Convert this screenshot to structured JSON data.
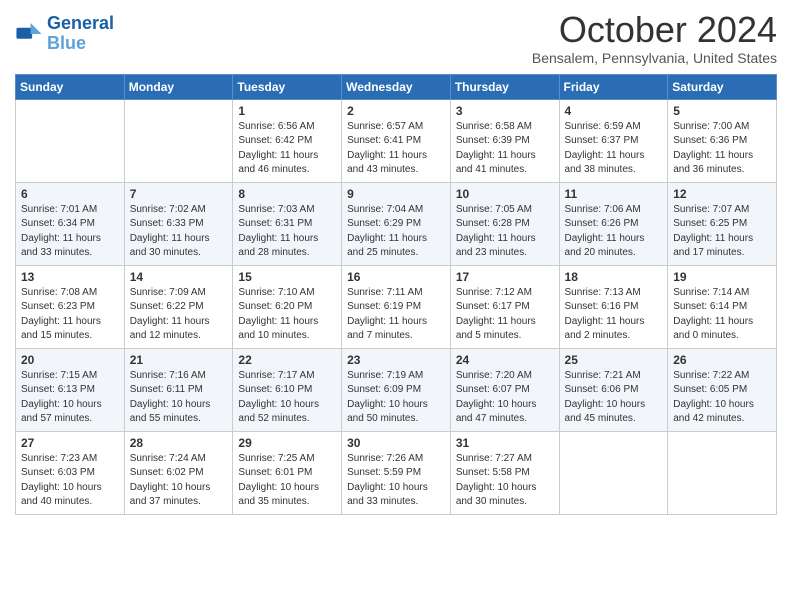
{
  "header": {
    "logo_line1": "General",
    "logo_line2": "Blue",
    "month": "October 2024",
    "location": "Bensalem, Pennsylvania, United States"
  },
  "weekdays": [
    "Sunday",
    "Monday",
    "Tuesday",
    "Wednesday",
    "Thursday",
    "Friday",
    "Saturday"
  ],
  "weeks": [
    [
      {
        "day": "",
        "info": ""
      },
      {
        "day": "",
        "info": ""
      },
      {
        "day": "1",
        "info": "Sunrise: 6:56 AM\nSunset: 6:42 PM\nDaylight: 11 hours and 46 minutes."
      },
      {
        "day": "2",
        "info": "Sunrise: 6:57 AM\nSunset: 6:41 PM\nDaylight: 11 hours and 43 minutes."
      },
      {
        "day": "3",
        "info": "Sunrise: 6:58 AM\nSunset: 6:39 PM\nDaylight: 11 hours and 41 minutes."
      },
      {
        "day": "4",
        "info": "Sunrise: 6:59 AM\nSunset: 6:37 PM\nDaylight: 11 hours and 38 minutes."
      },
      {
        "day": "5",
        "info": "Sunrise: 7:00 AM\nSunset: 6:36 PM\nDaylight: 11 hours and 36 minutes."
      }
    ],
    [
      {
        "day": "6",
        "info": "Sunrise: 7:01 AM\nSunset: 6:34 PM\nDaylight: 11 hours and 33 minutes."
      },
      {
        "day": "7",
        "info": "Sunrise: 7:02 AM\nSunset: 6:33 PM\nDaylight: 11 hours and 30 minutes."
      },
      {
        "day": "8",
        "info": "Sunrise: 7:03 AM\nSunset: 6:31 PM\nDaylight: 11 hours and 28 minutes."
      },
      {
        "day": "9",
        "info": "Sunrise: 7:04 AM\nSunset: 6:29 PM\nDaylight: 11 hours and 25 minutes."
      },
      {
        "day": "10",
        "info": "Sunrise: 7:05 AM\nSunset: 6:28 PM\nDaylight: 11 hours and 23 minutes."
      },
      {
        "day": "11",
        "info": "Sunrise: 7:06 AM\nSunset: 6:26 PM\nDaylight: 11 hours and 20 minutes."
      },
      {
        "day": "12",
        "info": "Sunrise: 7:07 AM\nSunset: 6:25 PM\nDaylight: 11 hours and 17 minutes."
      }
    ],
    [
      {
        "day": "13",
        "info": "Sunrise: 7:08 AM\nSunset: 6:23 PM\nDaylight: 11 hours and 15 minutes."
      },
      {
        "day": "14",
        "info": "Sunrise: 7:09 AM\nSunset: 6:22 PM\nDaylight: 11 hours and 12 minutes."
      },
      {
        "day": "15",
        "info": "Sunrise: 7:10 AM\nSunset: 6:20 PM\nDaylight: 11 hours and 10 minutes."
      },
      {
        "day": "16",
        "info": "Sunrise: 7:11 AM\nSunset: 6:19 PM\nDaylight: 11 hours and 7 minutes."
      },
      {
        "day": "17",
        "info": "Sunrise: 7:12 AM\nSunset: 6:17 PM\nDaylight: 11 hours and 5 minutes."
      },
      {
        "day": "18",
        "info": "Sunrise: 7:13 AM\nSunset: 6:16 PM\nDaylight: 11 hours and 2 minutes."
      },
      {
        "day": "19",
        "info": "Sunrise: 7:14 AM\nSunset: 6:14 PM\nDaylight: 11 hours and 0 minutes."
      }
    ],
    [
      {
        "day": "20",
        "info": "Sunrise: 7:15 AM\nSunset: 6:13 PM\nDaylight: 10 hours and 57 minutes."
      },
      {
        "day": "21",
        "info": "Sunrise: 7:16 AM\nSunset: 6:11 PM\nDaylight: 10 hours and 55 minutes."
      },
      {
        "day": "22",
        "info": "Sunrise: 7:17 AM\nSunset: 6:10 PM\nDaylight: 10 hours and 52 minutes."
      },
      {
        "day": "23",
        "info": "Sunrise: 7:19 AM\nSunset: 6:09 PM\nDaylight: 10 hours and 50 minutes."
      },
      {
        "day": "24",
        "info": "Sunrise: 7:20 AM\nSunset: 6:07 PM\nDaylight: 10 hours and 47 minutes."
      },
      {
        "day": "25",
        "info": "Sunrise: 7:21 AM\nSunset: 6:06 PM\nDaylight: 10 hours and 45 minutes."
      },
      {
        "day": "26",
        "info": "Sunrise: 7:22 AM\nSunset: 6:05 PM\nDaylight: 10 hours and 42 minutes."
      }
    ],
    [
      {
        "day": "27",
        "info": "Sunrise: 7:23 AM\nSunset: 6:03 PM\nDaylight: 10 hours and 40 minutes."
      },
      {
        "day": "28",
        "info": "Sunrise: 7:24 AM\nSunset: 6:02 PM\nDaylight: 10 hours and 37 minutes."
      },
      {
        "day": "29",
        "info": "Sunrise: 7:25 AM\nSunset: 6:01 PM\nDaylight: 10 hours and 35 minutes."
      },
      {
        "day": "30",
        "info": "Sunrise: 7:26 AM\nSunset: 5:59 PM\nDaylight: 10 hours and 33 minutes."
      },
      {
        "day": "31",
        "info": "Sunrise: 7:27 AM\nSunset: 5:58 PM\nDaylight: 10 hours and 30 minutes."
      },
      {
        "day": "",
        "info": ""
      },
      {
        "day": "",
        "info": ""
      }
    ]
  ]
}
